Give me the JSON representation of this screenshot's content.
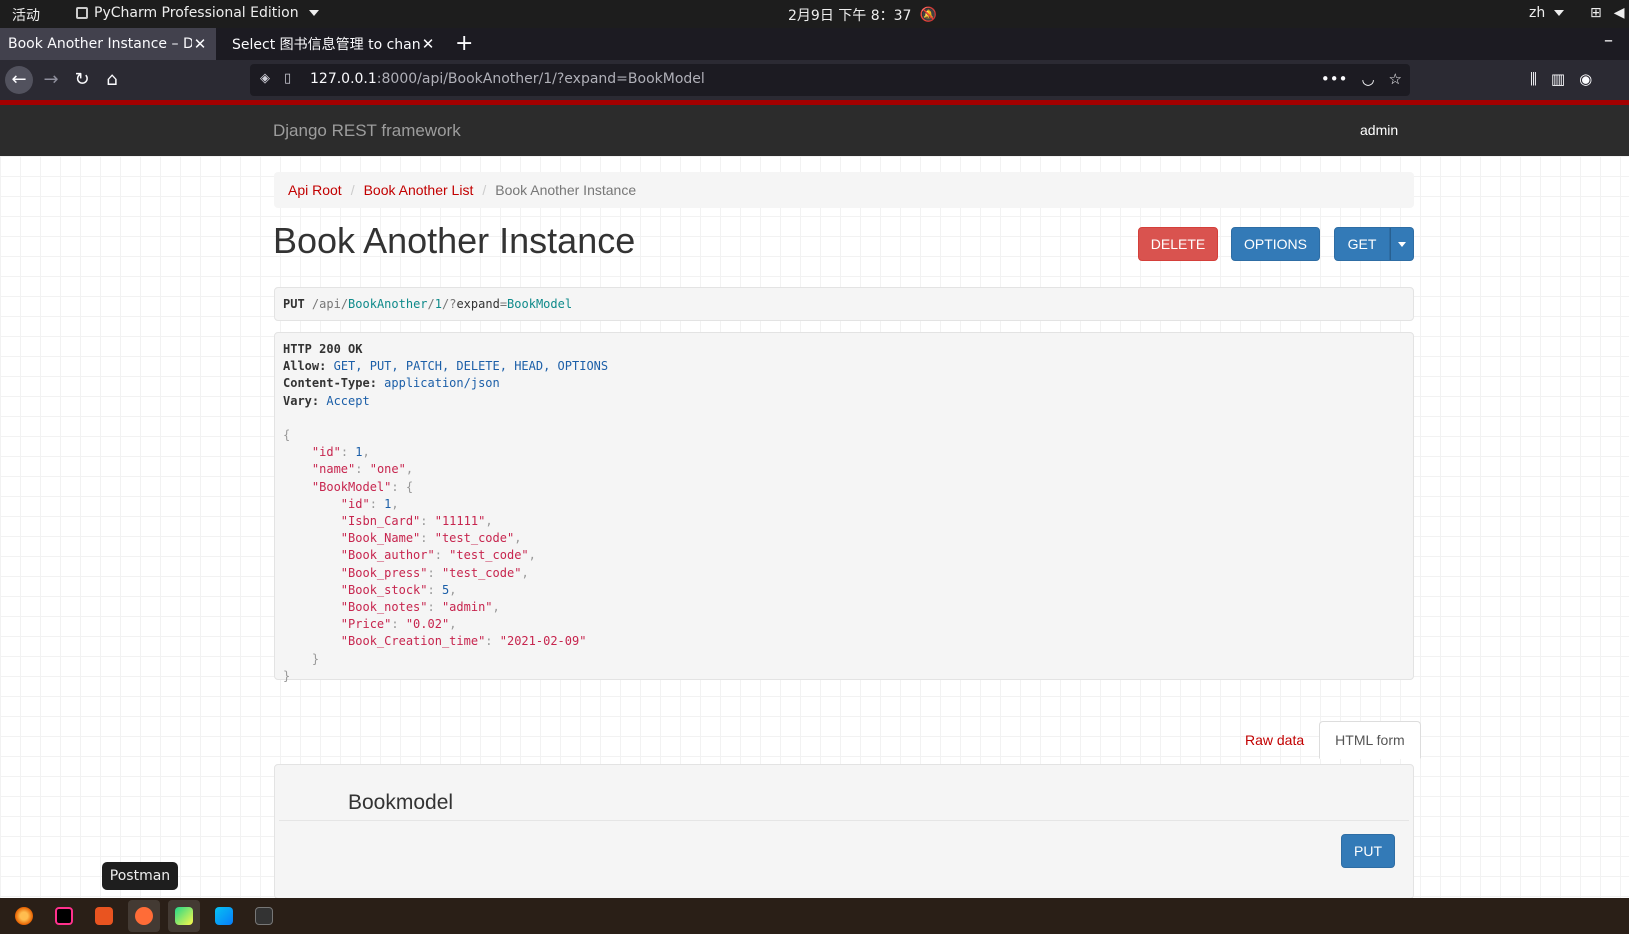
{
  "topbar": {
    "activities": "活动",
    "app_menu": "PyCharm Professional Edition",
    "clock": "2月9日  下午 8：37",
    "lang": "zh"
  },
  "browser": {
    "tabs": [
      {
        "title": "Book Another Instance – Dja",
        "active": true
      },
      {
        "title": "Select 图书信息管理 to chan",
        "active": false
      }
    ],
    "url_host": "127.0.0.1",
    "url_rest": ":8000/api/BookAnother/1/?expand=BookModel"
  },
  "drf": {
    "brand": "Django REST framework",
    "user": "admin",
    "breadcrumb": [
      "Api Root",
      "Book Another List",
      "Book Another Instance"
    ],
    "title": "Book Another Instance",
    "buttons": {
      "delete": "DELETE",
      "options": "OPTIONS",
      "get": "GET"
    },
    "request": {
      "method": "PUT",
      "path_prefix": "/api/",
      "seg1": "BookAnother",
      "seg2": "/",
      "seg3": "1",
      "seg4": "/?",
      "param": "expand",
      "eq": "=",
      "value": "BookModel"
    },
    "response": {
      "status": "HTTP 200 OK",
      "allow_label": "Allow:",
      "allow": "GET, PUT, PATCH, DELETE, HEAD, OPTIONS",
      "ctype_label": "Content-Type:",
      "ctype": "application/json",
      "vary_label": "Vary:",
      "vary": "Accept"
    },
    "json": {
      "id": "1",
      "name": "\"one\"",
      "book_model_key": "\"BookModel\"",
      "book_model": [
        {
          "k": "\"id\"",
          "v": "1",
          "type": "num"
        },
        {
          "k": "\"Isbn_Card\"",
          "v": "\"11111\"",
          "type": "str"
        },
        {
          "k": "\"Book_Name\"",
          "v": "\"test_code\"",
          "type": "str"
        },
        {
          "k": "\"Book_author\"",
          "v": "\"test_code\"",
          "type": "str"
        },
        {
          "k": "\"Book_press\"",
          "v": "\"test_code\"",
          "type": "str"
        },
        {
          "k": "\"Book_stock\"",
          "v": "5",
          "type": "num"
        },
        {
          "k": "\"Book_notes\"",
          "v": "\"admin\"",
          "type": "str"
        },
        {
          "k": "\"Price\"",
          "v": "\"0.02\"",
          "type": "str"
        },
        {
          "k": "\"Book_Creation_time\"",
          "v": "\"2021-02-09\"",
          "type": "str"
        }
      ]
    },
    "form_tabs": {
      "raw": "Raw data",
      "html": "HTML form"
    },
    "form_legend": "Bookmodel",
    "put_button": "PUT"
  },
  "tooltip": "Postman",
  "dock_apps": [
    "firefox-icon",
    "jetbrains-toolbox-icon",
    "software-center-icon",
    "postman-icon",
    "pycharm-icon",
    "webstorm-icon",
    "terminal-icon"
  ]
}
